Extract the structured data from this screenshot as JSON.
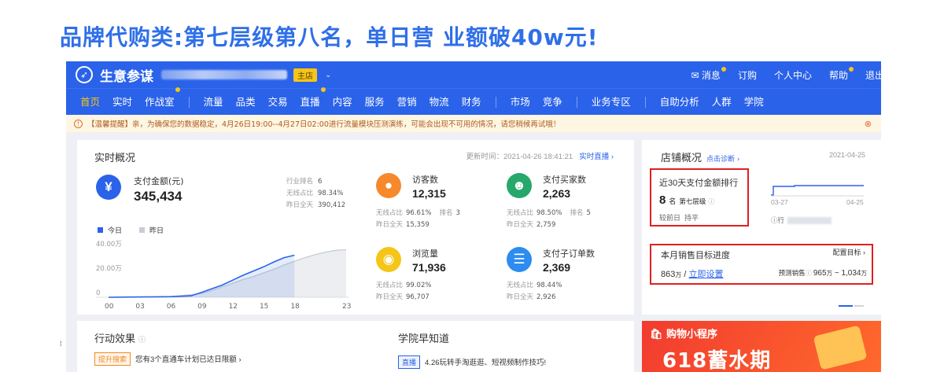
{
  "headline": "品牌代购类:第七层级第八名，单日营 业额破40w元!",
  "topbar": {
    "app_name": "生意参谋",
    "shop_badge": "主店",
    "links": [
      "消息",
      "订购",
      "个人中心",
      "帮助",
      "退出"
    ]
  },
  "nav": {
    "items_a": [
      "首页",
      "实时",
      "作战室"
    ],
    "items_b": [
      "流量",
      "品类",
      "交易",
      "直播",
      "内容",
      "服务",
      "营销",
      "物流",
      "财务"
    ],
    "items_c": [
      "市场",
      "竞争"
    ],
    "items_d": [
      "业务专区"
    ],
    "items_e": [
      "自助分析",
      "人群",
      "学院"
    ]
  },
  "notice": {
    "text": "【温馨提醒】亲，为确保您的数据稳定，4月26日19:00--4月27日02:00进行流量模块压测演练，可能会出现不可用的情况，请您稍候再试哦！"
  },
  "realtime": {
    "title": "实时概况",
    "update_label": "更新时间：2021-04-26 18:41:21",
    "live_link": "实时直播 ›",
    "pay_label": "支付金额(元)",
    "pay_value": "345,434",
    "rank_label": "行业排名",
    "rank_value": "6",
    "wireless_label": "无线占比",
    "wireless_value": "98.34%",
    "yesterday_label": "昨日全天",
    "yesterday_value": "390,412",
    "legend_today": "今日",
    "legend_yesterday": "昨日"
  },
  "metrics": [
    {
      "label": "访客数",
      "value": "12,315",
      "wireless": "96.61%",
      "rank_label": "排名",
      "rank": "3",
      "yesterday": "15,359",
      "color": "#f5892b"
    },
    {
      "label": "支付买家数",
      "value": "2,263",
      "wireless": "98.50%",
      "rank_label": "排名",
      "rank": "5",
      "yesterday": "2,759",
      "color": "#27a86b"
    },
    {
      "label": "浏览量",
      "value": "71,936",
      "wireless": "99.02%",
      "rank_label": "",
      "rank": "",
      "yesterday": "96,707",
      "color": "#f5c518"
    },
    {
      "label": "支付子订单数",
      "value": "2,369",
      "wireless": "98.44%",
      "rank_label": "",
      "rank": "",
      "yesterday": "2,926",
      "color": "#2c8cf0"
    }
  ],
  "metric_labels": {
    "wireless": "无线占比",
    "yesterday": "昨日全天"
  },
  "chart_data": {
    "type": "area",
    "x_ticks": [
      "00",
      "03",
      "06",
      "09",
      "12",
      "15",
      "18",
      "23"
    ],
    "y_ticks": [
      "40.00万",
      "20.00万",
      "0"
    ],
    "ylim": [
      0,
      400000
    ],
    "series": [
      {
        "name": "今日",
        "color": "#2a62ea",
        "x": [
          0,
          2,
          4,
          6,
          8,
          9,
          10,
          11,
          12,
          13,
          14,
          15,
          16,
          17,
          18
        ],
        "y": [
          0,
          2000,
          3000,
          5000,
          12000,
          40000,
          70000,
          100000,
          140000,
          180000,
          215000,
          250000,
          290000,
          325000,
          345434
        ]
      },
      {
        "name": "昨日",
        "color": "#c8cdd6",
        "x": [
          0,
          3,
          6,
          9,
          10,
          11,
          12,
          13,
          14,
          15,
          16,
          17,
          18,
          19,
          20,
          21,
          22,
          23
        ],
        "y": [
          0,
          3000,
          5000,
          30000,
          55000,
          85000,
          115000,
          145000,
          170000,
          200000,
          230000,
          265000,
          295000,
          325000,
          350000,
          370000,
          385000,
          390412
        ]
      }
    ]
  },
  "shop": {
    "title": "店铺概况",
    "diag_link": "点击诊断 ›",
    "date": "2021-04-25",
    "rank_title": "近30天支付金额排行",
    "rank_num": "8",
    "rank_unit": "名",
    "level": "第七层级",
    "compare_label": "较前日",
    "compare_value": "持平",
    "spark_start": "03-27",
    "spark_end": "04-25",
    "industry_label": "行",
    "target_title": "本月销售目标进度",
    "config_link": "配置目标 ›",
    "target_current": "863",
    "target_unit": "万",
    "target_sep": " / ",
    "target_set": "立即设置",
    "forecast_label": "预测销售",
    "forecast_value": "965",
    "forecast_unit": "万",
    "forecast_tilde": " ~ ",
    "forecast_value2": "1,034",
    "forecast_unit2": "万"
  },
  "action": {
    "title": "行动效果",
    "tag": "提升搜索",
    "text": "您有3个直通车计划已达日限额",
    "academy_title": "学院早知道",
    "academy_tag": "直播",
    "academy_text": "4.26玩转手淘逛逛、短视频制作技巧!"
  },
  "promo": {
    "title": "购物小程序",
    "big": "618蓄水期"
  }
}
